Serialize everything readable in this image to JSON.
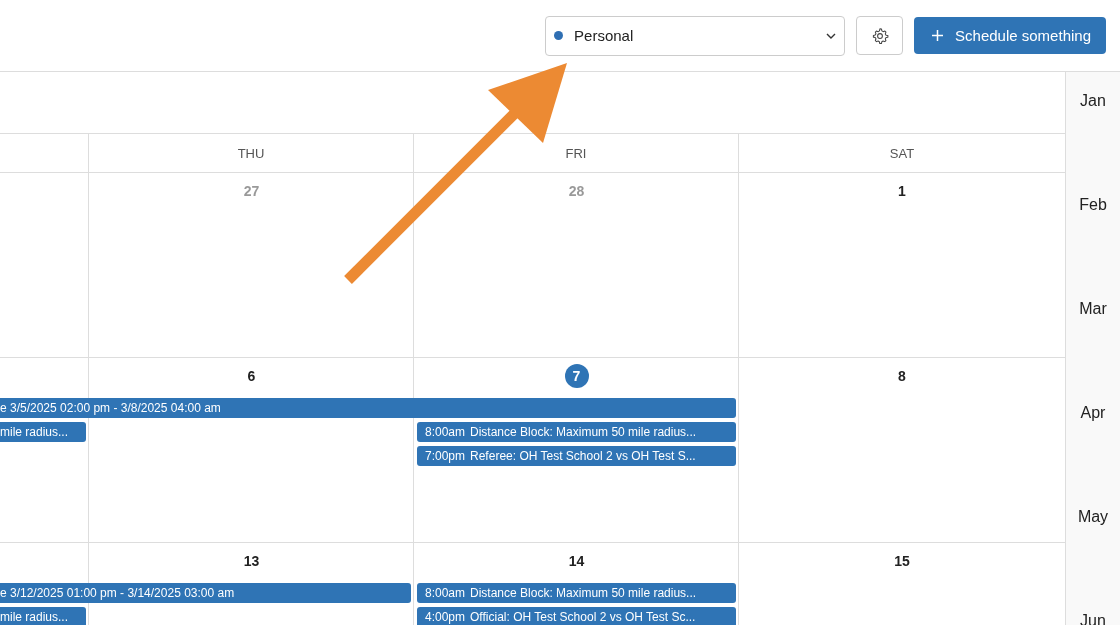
{
  "calendar_select": {
    "value": "Personal",
    "color": "#2f6fb3"
  },
  "schedule_button": {
    "label": "Schedule something"
  },
  "day_headers": [
    "THU",
    "FRI",
    "SAT"
  ],
  "weeks": [
    {
      "days": [
        {
          "number": "27",
          "muted": true,
          "today": false
        },
        {
          "number": "28",
          "muted": true,
          "today": false
        },
        {
          "number": "1",
          "muted": false,
          "today": false
        }
      ]
    },
    {
      "leading_events": [
        {
          "title": "mile radius..."
        }
      ],
      "days": [
        {
          "number": "6",
          "muted": false,
          "today": false
        },
        {
          "number": "7",
          "today": true,
          "spanning_event": {
            "title": "e 3/5/2025 02:00 pm - 3/8/2025 04:00 am"
          },
          "events": [
            {
              "time": "8:00am",
              "title": "Distance Block: Maximum 50 mile radius..."
            },
            {
              "time": "7:00pm",
              "title": "Referee: OH Test School 2 vs OH Test S..."
            }
          ]
        },
        {
          "number": "8",
          "muted": false,
          "today": false
        }
      ]
    },
    {
      "leading_events": [
        {
          "title": "mile radius..."
        }
      ],
      "days": [
        {
          "number": "13",
          "muted": false,
          "today": false,
          "spanning_event": {
            "title": "e 3/12/2025 01:00 pm - 3/14/2025 03:00 am"
          }
        },
        {
          "number": "14",
          "muted": false,
          "today": false,
          "events": [
            {
              "time": "8:00am",
              "title": "Distance Block: Maximum 50 mile radius..."
            },
            {
              "time": "4:00pm",
              "title": "Official: OH Test School 2 vs OH Test Sc..."
            }
          ]
        },
        {
          "number": "15",
          "muted": false,
          "today": false
        }
      ]
    }
  ],
  "months": [
    "Jan",
    "Feb",
    "Mar",
    "Apr",
    "May",
    "Jun"
  ]
}
